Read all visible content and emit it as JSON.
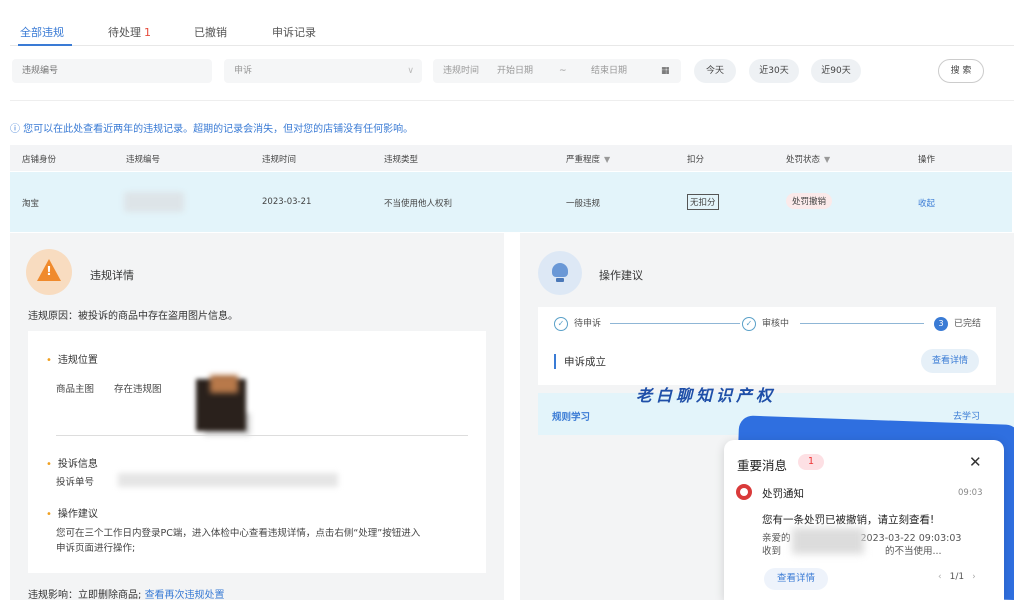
{
  "tabs": {
    "all": "全部违规",
    "pending": "待处理",
    "pending_count": "1",
    "revoked": "已撤销",
    "appeals": "申诉记录"
  },
  "filters": {
    "violation_id_placeholder": "违规编号",
    "status_value": "申诉",
    "time_label": "违规时间",
    "start_date": "开始日期",
    "tilde": "~",
    "end_date": "结束日期",
    "today": "今天",
    "last30": "近30天",
    "last90": "近90天",
    "search": "搜 索"
  },
  "notice": "ⓘ 您可以在此处查看近两年的违规记录。超期的记录会消失，但对您的店铺没有任何影响。",
  "table": {
    "headers": [
      "店铺身份",
      "违规编号",
      "违规时间",
      "违规类型",
      "严重程度",
      "扣分",
      "处罚状态",
      "操作"
    ],
    "row": {
      "shop": "淘宝",
      "time": "2023-03-21",
      "type": "不当使用他人权利",
      "severity": "一般违规",
      "points": "无扣分",
      "status": "处罚撤销",
      "action": "收起"
    }
  },
  "left": {
    "title": "违规详情",
    "reason": "违规原因：被投诉的商品中存在盗用图片信息。",
    "location_title": "违规位置",
    "location_main": "商品主图",
    "location_img": "存在违规图",
    "complaint_title": "投诉信息",
    "complaint_text": "投诉单号",
    "advice_title": "操作建议",
    "advice_line1": "您可在三个工作日内登录PC端，进入体检中心查看违规详情，点击右侧“处理”按钮进入",
    "advice_line2": "申诉页面进行操作;",
    "impact_prefix": "违规影响：立即删除商品; ",
    "impact_link": "查看再次违规处置"
  },
  "right": {
    "title": "操作建议",
    "step1": "待申诉",
    "step2": "审核中",
    "step3_num": "3",
    "step3": "已完结",
    "appeal_result": "申诉成立",
    "view_details": "查看详情",
    "rules_title": "规则学习",
    "rules_link": "去学习"
  },
  "watermark": "老白聊知识产权",
  "popup": {
    "title": "重要消息",
    "badge": "1",
    "close": "✕",
    "notif_title": "处罚通知",
    "notif_time": "09:03",
    "notif_body": "您有一条处罚已被撤销，请立刻查看!",
    "line1_prefix": "亲爱的",
    "line1_suffix": "2023-03-22 09:03:03",
    "line2_prefix": "收到",
    "line2_suffix": "的不当使用...",
    "view_btn": "查看详情",
    "pager": "1/1"
  }
}
